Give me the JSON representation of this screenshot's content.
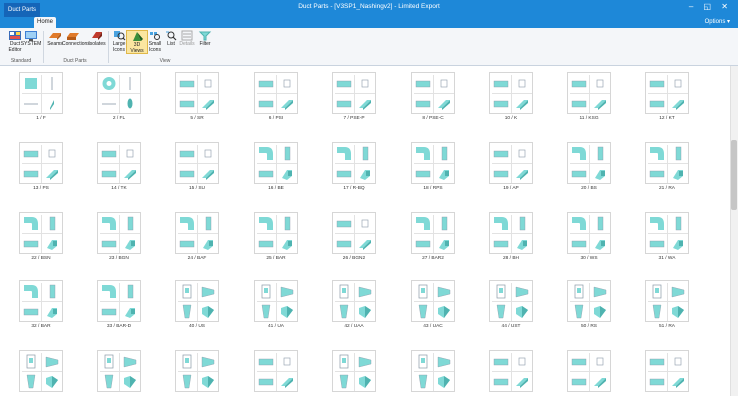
{
  "window": {
    "app_tab": "Duct Parts",
    "title": "Duct Parts - [V3SP1_Nashingv2] - Limited Export",
    "controls": "– ◱ ✕",
    "options_label": "Options ▾"
  },
  "ribbon": {
    "tabs": [
      {
        "label": "Home"
      }
    ],
    "buttons": [
      {
        "label": "Duct Editor",
        "icon": "duct-editor-icon"
      },
      {
        "label": "SYSTEM",
        "icon": "system-icon"
      },
      {
        "label": "Seams",
        "icon": "seams-icon"
      },
      {
        "label": "Connections",
        "icon": "connections-icon"
      },
      {
        "label": "Isolates",
        "icon": "isolates-icon"
      },
      {
        "label": "Large Icons",
        "icon": "large-icons-icon"
      },
      {
        "label": "3D Views",
        "icon": "3d-views-icon",
        "active": true
      },
      {
        "label": "Small Icons",
        "icon": "small-icons-icon"
      },
      {
        "label": "List",
        "icon": "list-icon"
      },
      {
        "label": "Details",
        "icon": "details-icon"
      },
      {
        "label": "Filter",
        "icon": "filter-icon"
      }
    ],
    "groups": [
      "Standard",
      "Duct Parts",
      "View"
    ]
  },
  "colors": {
    "accent": "#1e88d8",
    "part": "#7fd9d6",
    "part_dark": "#4fb3b0",
    "outline": "#8a9aa8"
  },
  "parts": [
    {
      "label": "1 / F",
      "shape": "flat"
    },
    {
      "label": "2 / FL",
      "shape": "ring"
    },
    {
      "label": "5 / SR",
      "shape": "duct"
    },
    {
      "label": "6 / PSI",
      "shape": "duct"
    },
    {
      "label": "7 / PSE-P",
      "shape": "duct"
    },
    {
      "label": "8 / PSE-C",
      "shape": "duct"
    },
    {
      "label": "10 / K",
      "shape": "duct"
    },
    {
      "label": "11 / KSG",
      "shape": "duct"
    },
    {
      "label": "12 / KT",
      "shape": "duct"
    },
    {
      "label": "13 / PS",
      "shape": "duct"
    },
    {
      "label": "14 / TK",
      "shape": "duct"
    },
    {
      "label": "15 / SU",
      "shape": "duct"
    },
    {
      "label": "16 / BE",
      "shape": "elbow"
    },
    {
      "label": "17 / R-BQ",
      "shape": "elbow"
    },
    {
      "label": "18 / RPS",
      "shape": "elbow"
    },
    {
      "label": "19 / AP",
      "shape": "duct"
    },
    {
      "label": "20 / BS",
      "shape": "elbow"
    },
    {
      "label": "21 / RA",
      "shape": "elbow"
    },
    {
      "label": "22 / BSN",
      "shape": "elbow"
    },
    {
      "label": "23 / BGN",
      "shape": "elbow"
    },
    {
      "label": "24 / BAF",
      "shape": "elbow"
    },
    {
      "label": "25 / BAR",
      "shape": "elbow"
    },
    {
      "label": "26 / BGN2",
      "shape": "duct"
    },
    {
      "label": "27 / BAR2",
      "shape": "elbow"
    },
    {
      "label": "28 / BH",
      "shape": "elbow"
    },
    {
      "label": "30 / WS",
      "shape": "elbow"
    },
    {
      "label": "31 / WA",
      "shape": "elbow"
    },
    {
      "label": "32 / BAR",
      "shape": "elbow"
    },
    {
      "label": "33 / BAR-D",
      "shape": "elbow"
    },
    {
      "label": "40 / US",
      "shape": "transition"
    },
    {
      "label": "41 / UA",
      "shape": "transition"
    },
    {
      "label": "42 / UAA",
      "shape": "transition"
    },
    {
      "label": "43 / UAC",
      "shape": "transition"
    },
    {
      "label": "44 / UST",
      "shape": "transition"
    },
    {
      "label": "50 / RS",
      "shape": "transition"
    },
    {
      "label": "51 / RA",
      "shape": "transition"
    },
    {
      "label": "",
      "shape": "transition"
    },
    {
      "label": "",
      "shape": "transition"
    },
    {
      "label": "",
      "shape": "transition"
    },
    {
      "label": "",
      "shape": "duct"
    },
    {
      "label": "",
      "shape": "transition"
    },
    {
      "label": "",
      "shape": "transition"
    },
    {
      "label": "",
      "shape": "duct"
    },
    {
      "label": "",
      "shape": "duct"
    },
    {
      "label": "",
      "shape": "duct"
    }
  ]
}
